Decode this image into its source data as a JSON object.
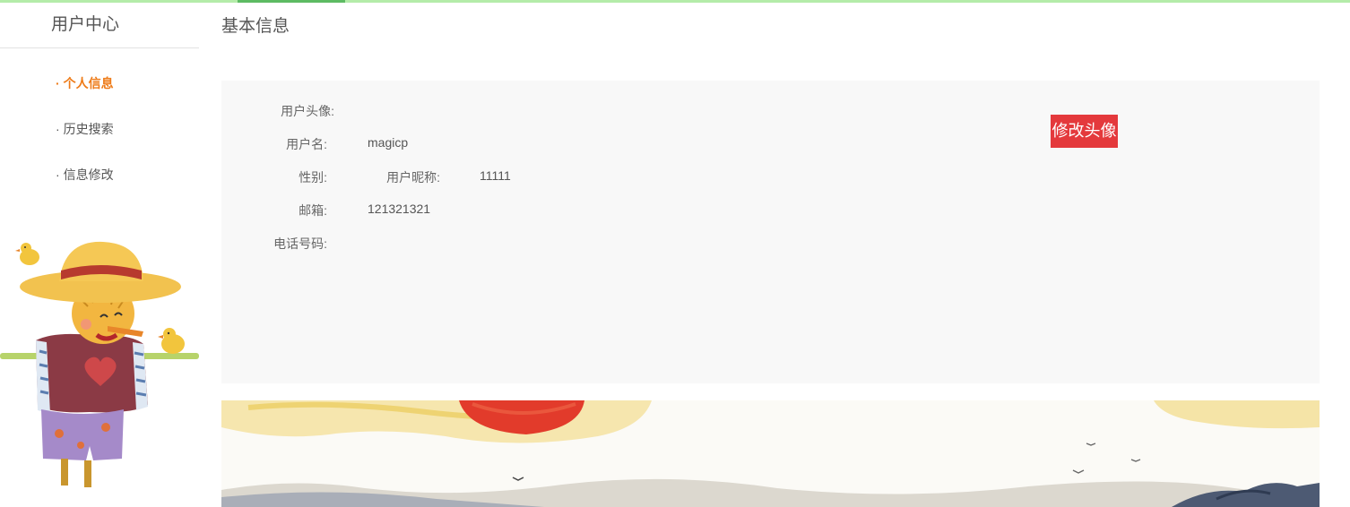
{
  "sidebar": {
    "title": "用户中心",
    "items": [
      {
        "dot": "·",
        "label": "个人信息",
        "active": true
      },
      {
        "dot": "·",
        "label": "历史搜索",
        "active": false
      },
      {
        "dot": "·",
        "label": "信息修改",
        "active": false
      }
    ]
  },
  "main": {
    "title": "基本信息",
    "fields": {
      "avatar_label": "用户头像:",
      "username_label": "用户名:",
      "username_value": "magicp",
      "gender_label": "性别:",
      "nickname_label": "用户昵称:",
      "nickname_value": "11111",
      "email_label": "邮箱:",
      "email_value": "121321321",
      "phone_label": "电话号码:"
    },
    "change_avatar_button": "修改头像"
  },
  "colors": {
    "accent_orange": "#ee7b18",
    "button_red": "#e4393c",
    "topbar_green": "#b4eca9",
    "panel_bg": "#f8f8f8"
  }
}
